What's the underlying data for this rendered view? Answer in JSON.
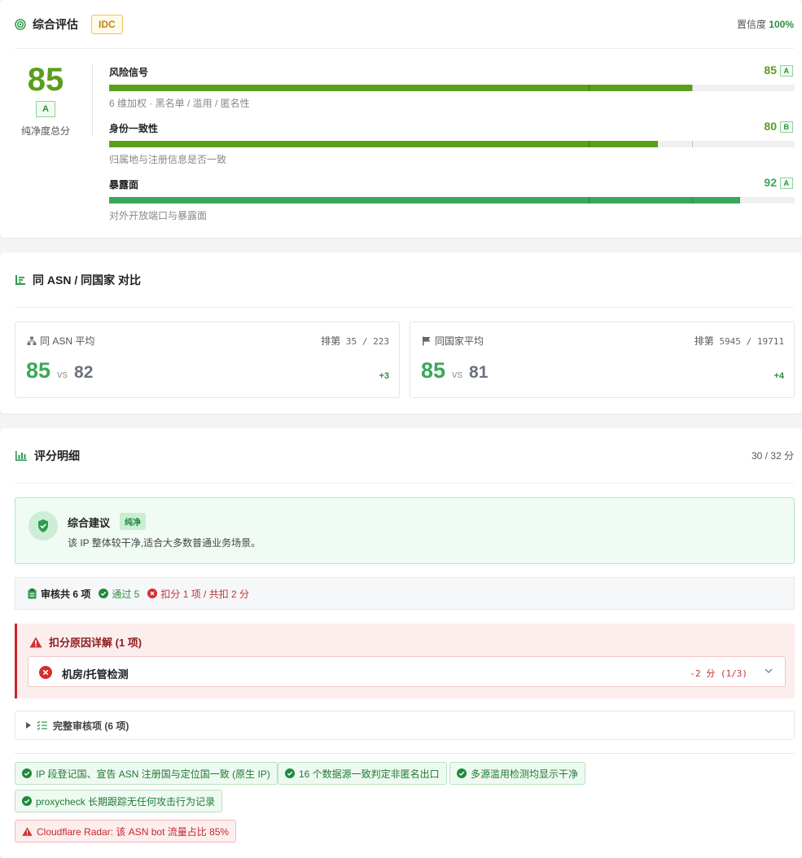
{
  "overall": {
    "title": "综合评估",
    "type_badge": "IDC",
    "confidence_label": "置信度",
    "confidence_value": "100%",
    "score": "85",
    "grade": "A",
    "score_label": "纯净度总分",
    "metrics": [
      {
        "name": "风险信号",
        "value": "85",
        "score": 85,
        "grade": "A",
        "color": "#5a9e1b",
        "desc": "6 维加权 · 黑名单 / 滥用 / 匿名性"
      },
      {
        "name": "身份一致性",
        "value": "80",
        "score": 80,
        "grade": "B",
        "color": "#5a9e1b",
        "desc": "归属地与注册信息是否一致"
      },
      {
        "name": "暴露面",
        "value": "92",
        "score": 92,
        "grade": "A",
        "color": "#3aa757",
        "desc": "对外开放端口与暴露面"
      }
    ]
  },
  "compare": {
    "title": "同 ASN / 同国家 对比",
    "asn": {
      "label": "同 ASN 平均",
      "rank_label": "排第",
      "rank": "35",
      "sep": "/",
      "total": "223",
      "value": "85",
      "vs": "vs",
      "avg": "82",
      "diff": "+3"
    },
    "country": {
      "label": "同国家平均",
      "rank_label": "排第",
      "rank": "5945",
      "sep": "/",
      "total": "19711",
      "value": "85",
      "vs": "vs",
      "avg": "81",
      "diff": "+4"
    }
  },
  "detail": {
    "title": "评分明细",
    "score_summary": "30 / 32 分",
    "advice_title": "综合建议",
    "advice_badge": "纯净",
    "advice_text": "该 IP 整体较干净,适合大多数普通业务场景。",
    "audit_total": "审核共 6 项",
    "audit_pass": "通过 5",
    "audit_deduct": "扣分 1 项 / 共扣 2 分",
    "reason_title": "扣分原因详解 (1 项)",
    "reason_item_name": "机房/托管检测",
    "reason_item_points": "-2 分 (1/3)",
    "full_list_label": "完整审核项 (6 项)",
    "tags": [
      {
        "text": "IP 段登记国、宣告 ASN 注册国与定位国一致 (原生 IP)",
        "status": "ok"
      },
      {
        "text": "16 个数据源一致判定非匿名出口",
        "status": "ok"
      },
      {
        "text": "多源滥用检测均显示干净",
        "status": "ok"
      },
      {
        "text": "proxycheck 长期跟踪无任何攻击行为记录",
        "status": "ok"
      },
      {
        "text": "Cloudflare Radar: 该 ASN bot 流量占比 85%",
        "status": "bad"
      }
    ]
  }
}
